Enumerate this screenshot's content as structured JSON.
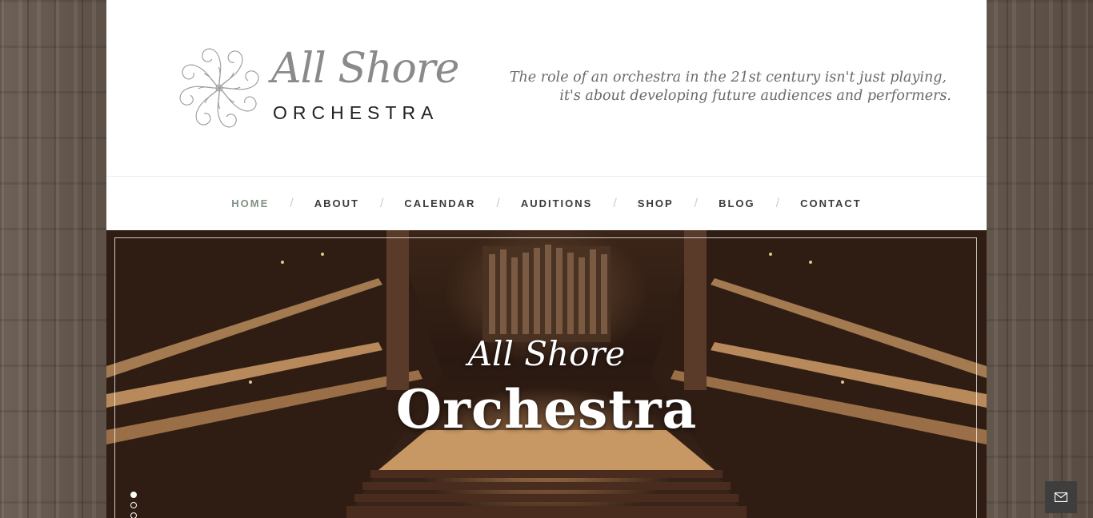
{
  "header": {
    "logo_script": "All Shore",
    "logo_sub": "ORCHESTRA",
    "tagline_line1": "The role of an orchestra in the 21st century isn't just playing,",
    "tagline_line2": "it's about developing future audiences and performers."
  },
  "nav": {
    "items": [
      {
        "label": "HOME",
        "active": true
      },
      {
        "label": "ABOUT"
      },
      {
        "label": "CALENDAR"
      },
      {
        "label": "AUDITIONS"
      },
      {
        "label": "SHOP"
      },
      {
        "label": "BLOG"
      },
      {
        "label": "CONTACT"
      }
    ],
    "separator": "/"
  },
  "hero": {
    "title_line1": "All Shore",
    "title_line2": "Orchestra",
    "slides_active": 0,
    "slide_count": 3
  },
  "icons": {
    "logo_mark": "spiral-flower-icon",
    "contact_float": "envelope-icon"
  },
  "colors": {
    "nav_active": "#7f9283",
    "nav_text": "#3a3a3a",
    "mail_button": "#3e3e3e"
  }
}
